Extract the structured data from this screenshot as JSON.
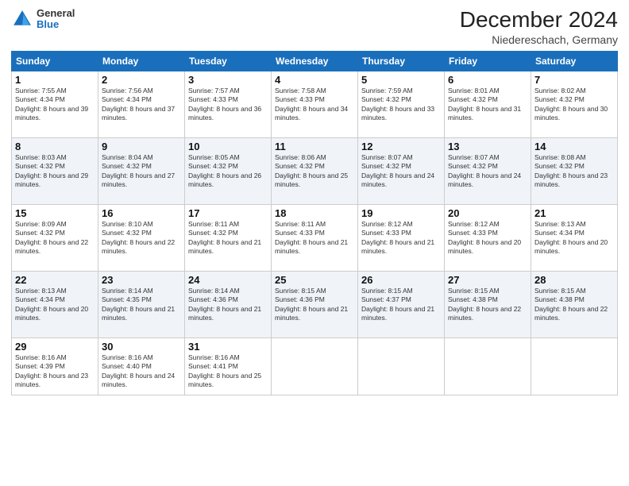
{
  "logo": {
    "general": "General",
    "blue": "Blue"
  },
  "header": {
    "month": "December 2024",
    "location": "Niedereschach, Germany"
  },
  "weekdays": [
    "Sunday",
    "Monday",
    "Tuesday",
    "Wednesday",
    "Thursday",
    "Friday",
    "Saturday"
  ],
  "weeks": [
    [
      {
        "day": "1",
        "sunrise": "7:55 AM",
        "sunset": "4:34 PM",
        "daylight": "8 hours and 39 minutes."
      },
      {
        "day": "2",
        "sunrise": "7:56 AM",
        "sunset": "4:34 PM",
        "daylight": "8 hours and 37 minutes."
      },
      {
        "day": "3",
        "sunrise": "7:57 AM",
        "sunset": "4:33 PM",
        "daylight": "8 hours and 36 minutes."
      },
      {
        "day": "4",
        "sunrise": "7:58 AM",
        "sunset": "4:33 PM",
        "daylight": "8 hours and 34 minutes."
      },
      {
        "day": "5",
        "sunrise": "7:59 AM",
        "sunset": "4:32 PM",
        "daylight": "8 hours and 33 minutes."
      },
      {
        "day": "6",
        "sunrise": "8:01 AM",
        "sunset": "4:32 PM",
        "daylight": "8 hours and 31 minutes."
      },
      {
        "day": "7",
        "sunrise": "8:02 AM",
        "sunset": "4:32 PM",
        "daylight": "8 hours and 30 minutes."
      }
    ],
    [
      {
        "day": "8",
        "sunrise": "8:03 AM",
        "sunset": "4:32 PM",
        "daylight": "8 hours and 29 minutes."
      },
      {
        "day": "9",
        "sunrise": "8:04 AM",
        "sunset": "4:32 PM",
        "daylight": "8 hours and 27 minutes."
      },
      {
        "day": "10",
        "sunrise": "8:05 AM",
        "sunset": "4:32 PM",
        "daylight": "8 hours and 26 minutes."
      },
      {
        "day": "11",
        "sunrise": "8:06 AM",
        "sunset": "4:32 PM",
        "daylight": "8 hours and 25 minutes."
      },
      {
        "day": "12",
        "sunrise": "8:07 AM",
        "sunset": "4:32 PM",
        "daylight": "8 hours and 24 minutes."
      },
      {
        "day": "13",
        "sunrise": "8:07 AM",
        "sunset": "4:32 PM",
        "daylight": "8 hours and 24 minutes."
      },
      {
        "day": "14",
        "sunrise": "8:08 AM",
        "sunset": "4:32 PM",
        "daylight": "8 hours and 23 minutes."
      }
    ],
    [
      {
        "day": "15",
        "sunrise": "8:09 AM",
        "sunset": "4:32 PM",
        "daylight": "8 hours and 22 minutes."
      },
      {
        "day": "16",
        "sunrise": "8:10 AM",
        "sunset": "4:32 PM",
        "daylight": "8 hours and 22 minutes."
      },
      {
        "day": "17",
        "sunrise": "8:11 AM",
        "sunset": "4:32 PM",
        "daylight": "8 hours and 21 minutes."
      },
      {
        "day": "18",
        "sunrise": "8:11 AM",
        "sunset": "4:33 PM",
        "daylight": "8 hours and 21 minutes."
      },
      {
        "day": "19",
        "sunrise": "8:12 AM",
        "sunset": "4:33 PM",
        "daylight": "8 hours and 21 minutes."
      },
      {
        "day": "20",
        "sunrise": "8:12 AM",
        "sunset": "4:33 PM",
        "daylight": "8 hours and 20 minutes."
      },
      {
        "day": "21",
        "sunrise": "8:13 AM",
        "sunset": "4:34 PM",
        "daylight": "8 hours and 20 minutes."
      }
    ],
    [
      {
        "day": "22",
        "sunrise": "8:13 AM",
        "sunset": "4:34 PM",
        "daylight": "8 hours and 20 minutes."
      },
      {
        "day": "23",
        "sunrise": "8:14 AM",
        "sunset": "4:35 PM",
        "daylight": "8 hours and 21 minutes."
      },
      {
        "day": "24",
        "sunrise": "8:14 AM",
        "sunset": "4:36 PM",
        "daylight": "8 hours and 21 minutes."
      },
      {
        "day": "25",
        "sunrise": "8:15 AM",
        "sunset": "4:36 PM",
        "daylight": "8 hours and 21 minutes."
      },
      {
        "day": "26",
        "sunrise": "8:15 AM",
        "sunset": "4:37 PM",
        "daylight": "8 hours and 21 minutes."
      },
      {
        "day": "27",
        "sunrise": "8:15 AM",
        "sunset": "4:38 PM",
        "daylight": "8 hours and 22 minutes."
      },
      {
        "day": "28",
        "sunrise": "8:15 AM",
        "sunset": "4:38 PM",
        "daylight": "8 hours and 22 minutes."
      }
    ],
    [
      {
        "day": "29",
        "sunrise": "8:16 AM",
        "sunset": "4:39 PM",
        "daylight": "8 hours and 23 minutes."
      },
      {
        "day": "30",
        "sunrise": "8:16 AM",
        "sunset": "4:40 PM",
        "daylight": "8 hours and 24 minutes."
      },
      {
        "day": "31",
        "sunrise": "8:16 AM",
        "sunset": "4:41 PM",
        "daylight": "8 hours and 25 minutes."
      },
      null,
      null,
      null,
      null
    ]
  ]
}
